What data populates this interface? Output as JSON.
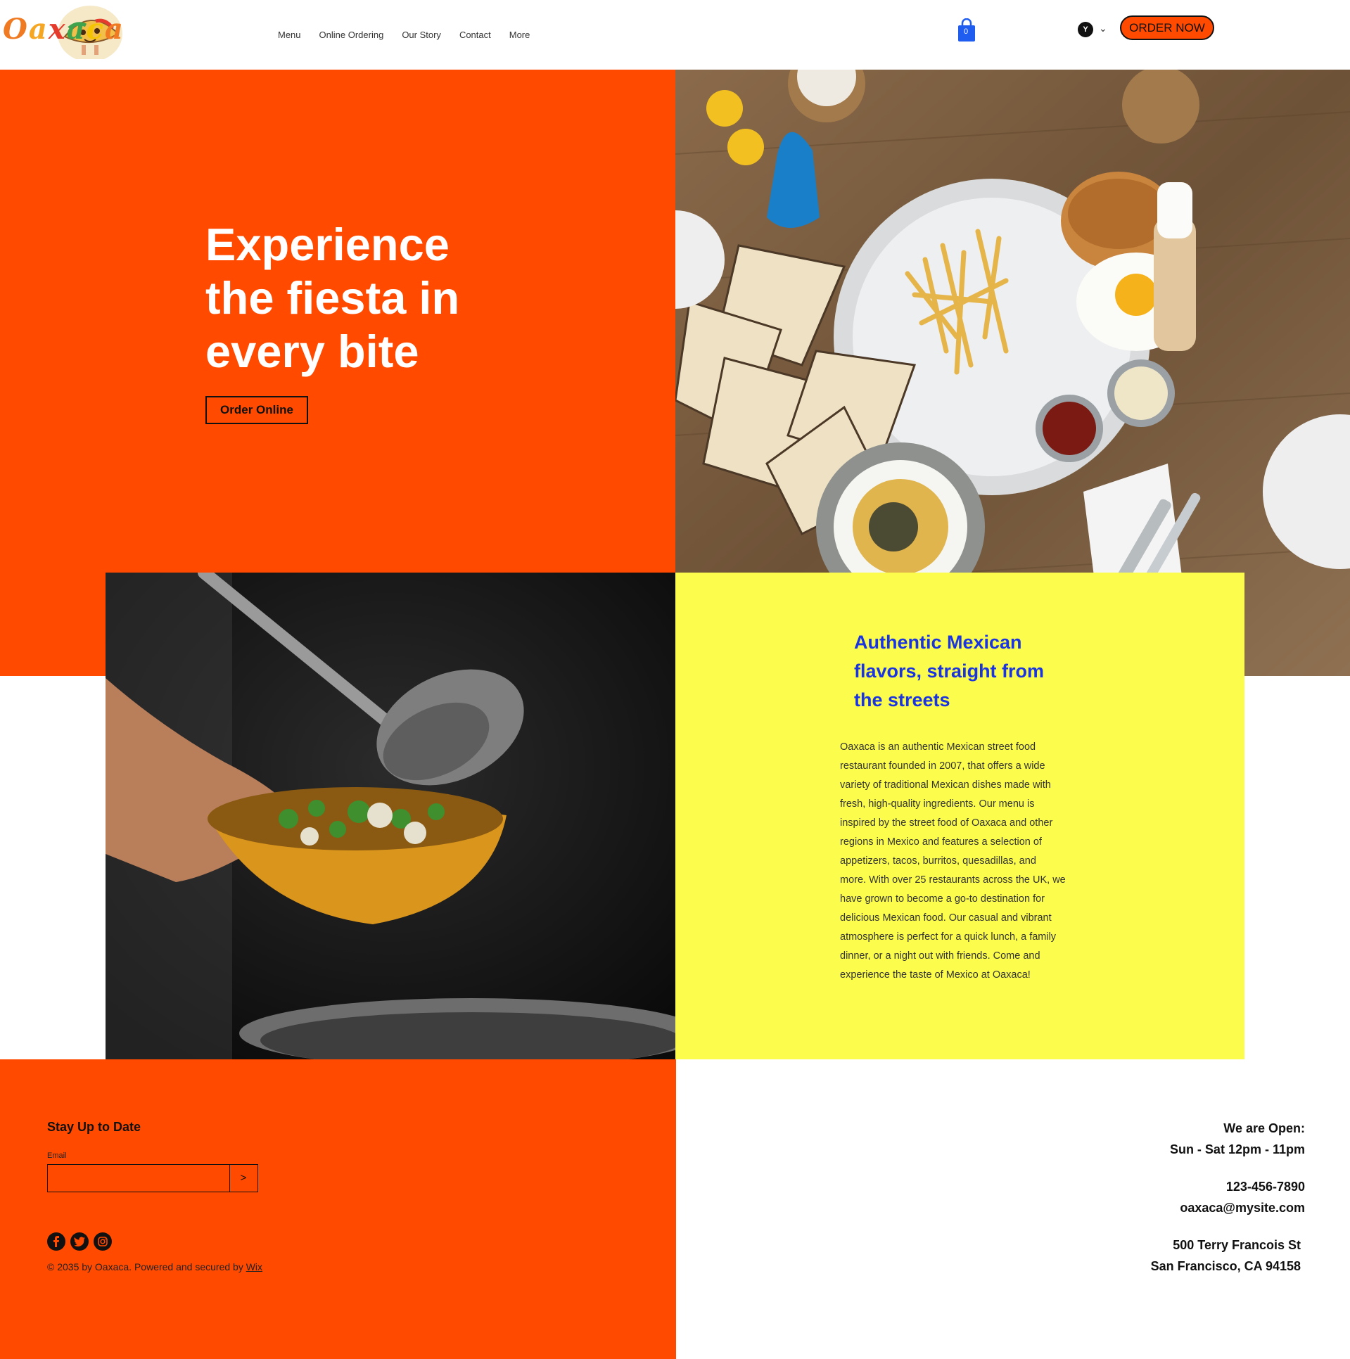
{
  "header": {
    "logo_text": "Oaxaca",
    "nav": [
      "Menu",
      "Online Ordering",
      "Our Story",
      "Contact",
      "More"
    ],
    "cart_count": "0",
    "language_code": "Y",
    "order_button": "ORDER NOW"
  },
  "hero": {
    "title_lines": [
      "Experience",
      "the fiesta in",
      "every bite"
    ],
    "cta": "Order Online"
  },
  "about": {
    "title_lines": [
      "Authentic Mexican",
      "flavors, straight from",
      "the streets"
    ],
    "body_lines": [
      "Oaxaca is an authentic Mexican street food",
      "restaurant founded in 2007, that offers a wide",
      "variety of traditional Mexican dishes made with",
      "fresh, high-quality ingredients. Our menu is",
      "inspired by the street food of Oaxaca and other",
      "regions in Mexico and features a selection of",
      "appetizers, tacos, burritos, quesadillas, and",
      "more. With over 25 restaurants across the UK, we",
      "have grown to become a go-to destination for",
      "delicious Mexican food. Our casual and vibrant",
      "atmosphere is perfect for a quick lunch, a family",
      "dinner, or a night out with friends. Come and",
      "experience the taste of Mexico at Oaxaca!"
    ]
  },
  "footer": {
    "newsletter_title": "Stay Up to Date",
    "email_label": "Email",
    "email_value": "",
    "submit_label": ">",
    "social_icons": [
      "facebook-icon",
      "twitter-icon",
      "instagram-icon"
    ],
    "copyright_prefix": "© 2035 by Oaxaca. Powered and secured by ",
    "copyright_link": "Wix",
    "hours_title": "We are Open:",
    "hours": "Sun - Sat 12pm - 11pm",
    "phone": "123-456-7890",
    "email": "oaxaca@mysite.com",
    "address_line1": "500 Terry Francois St",
    "address_line2": "San Francisco, CA 94158"
  },
  "colors": {
    "brand_orange": "#ff4a00",
    "yellow": "#fcfc4c",
    "heading_blue": "#1a35e0",
    "cart_blue": "#1f5cf0"
  }
}
